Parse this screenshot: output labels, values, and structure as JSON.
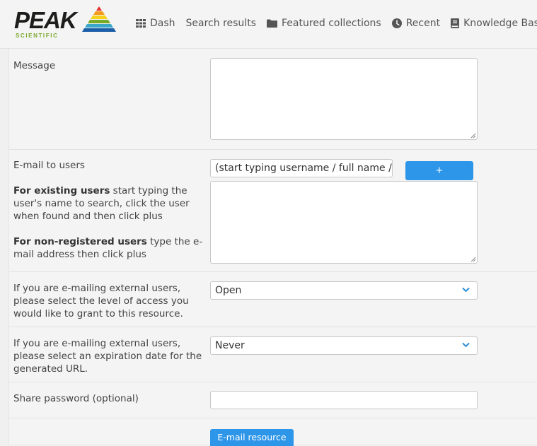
{
  "brand": {
    "name": "PEAK",
    "sub": "SCIENTIFIC"
  },
  "nav": {
    "dash": "Dash",
    "search_results": "Search results",
    "featured_collections": "Featured collections",
    "recent": "Recent",
    "knowledge_base": "Knowledge Base"
  },
  "form": {
    "message_label": "Message",
    "message_value": "",
    "email_users_label": "E-mail to users",
    "email_users_placeholder": "(start typing username / full name / gro",
    "plus_label": "+",
    "existing_users_bold": "For existing users",
    "existing_users_text": " start typing the user's name to search, click the user when found and then click plus",
    "nonreg_users_bold": "For non-registered users",
    "nonreg_users_text": " type the e-mail address then click plus",
    "access_label": "If you are e-mailing external users, please select the level of access you would like to grant to this resource.",
    "access_value": "Open",
    "expiry_label": "If you are e-mailing external users, please select an expiration date for the generated URL.",
    "expiry_value": "Never",
    "password_label": "Share password (optional)",
    "password_value": "",
    "submit_label": "E-mail resource"
  },
  "colors": {
    "accent": "#2e96e8",
    "brand_green": "#7aaa2a"
  },
  "icons": [
    "grid-icon",
    "folder-icon",
    "clock-icon",
    "book-icon",
    "chevron-down-icon"
  ]
}
